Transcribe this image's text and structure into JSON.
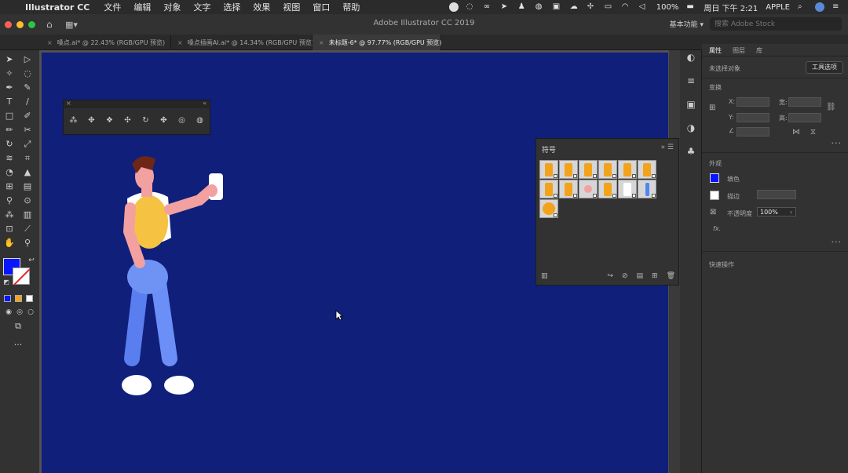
{
  "menubar": {
    "app_name": "Illustrator CC",
    "items": [
      "文件",
      "编辑",
      "对象",
      "文字",
      "选择",
      "效果",
      "视图",
      "窗口",
      "帮助"
    ],
    "battery": "100%",
    "datetime": "周日 下午 2:21",
    "user": "APPLE"
  },
  "window": {
    "title": "Adobe Illustrator CC 2019",
    "workspace": "基本功能",
    "stock_search_placeholder": "搜索 Adobe Stock"
  },
  "tabs": [
    {
      "label": "嗓点.ai* @ 22.43% (RGB/GPU 预览)"
    },
    {
      "label": "嗓点插画AI.ai* @ 14.34% (RGB/GPU 预览)"
    },
    {
      "label": "未标题-6* @ 97.77% (RGB/GPU 预览)",
      "active": true
    }
  ],
  "colors": {
    "artboard": "#0f1f7a",
    "fill": "#0a15ff",
    "accent_orange": "#f2a31b"
  },
  "symbols_panel": {
    "title": "符号",
    "symbol_count": 13
  },
  "properties": {
    "tabs": [
      "属性",
      "图层",
      "库"
    ],
    "no_selection": "未选择对象",
    "tool_options_button": "工具选项",
    "transform_label": "变换",
    "x_label": "X:",
    "y_label": "Y:",
    "w_label": "宽:",
    "h_label": "高:",
    "appearance_label": "外观",
    "fill_label": "填色",
    "stroke_label": "描边",
    "opacity_label": "不透明度",
    "opacity_value": "100%",
    "fx_label": "fx.",
    "quick_actions_label": "快速操作"
  }
}
